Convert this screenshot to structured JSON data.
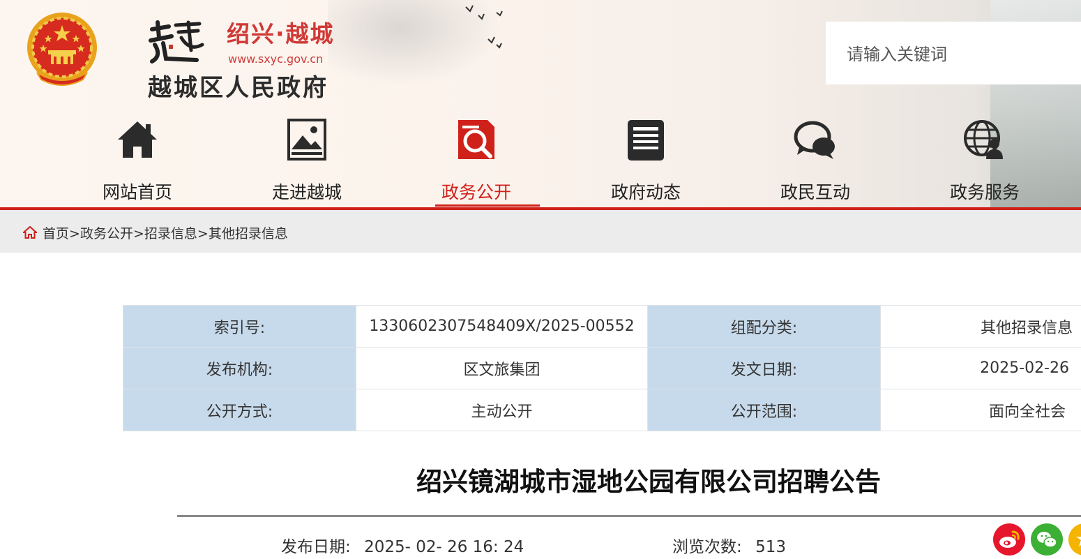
{
  "header": {
    "brand_red": "绍兴·越城",
    "brand_url": "www.sxyc.gov.cn",
    "brand_name": "越城区人民政府",
    "search_placeholder": "请输入关键词"
  },
  "nav": {
    "active": "政务公开",
    "items": [
      {
        "label": "网站首页",
        "icon": "home-icon"
      },
      {
        "label": "走进越城",
        "icon": "picture-icon"
      },
      {
        "label": "政务公开",
        "icon": "search-document-icon"
      },
      {
        "label": "政府动态",
        "icon": "news-icon"
      },
      {
        "label": "政民互动",
        "icon": "chat-icon"
      },
      {
        "label": "政务服务",
        "icon": "globe-user-icon"
      }
    ]
  },
  "breadcrumb": {
    "items": [
      "首页",
      "政务公开",
      "招录信息",
      "其他招录信息"
    ],
    "separator": ">"
  },
  "info": {
    "index_label": "索引号:",
    "index_value": "1330602307548409X/2025-00552",
    "category_label": "组配分类:",
    "category_value": "其他招录信息",
    "publisher_label": "发布机构:",
    "publisher_value": "区文旅集团",
    "doc_date_label": "发文日期:",
    "doc_date_value": "2025-02-26",
    "open_mode_label": "公开方式:",
    "open_mode_value": "主动公开",
    "open_scope_label": "公开范围:",
    "open_scope_value": "面向全社会"
  },
  "article": {
    "title": "绍兴镜湖城市湿地公园有限公司招聘公告",
    "publish_label": "发布日期:",
    "publish_value": "2025- 02- 26 16: 24",
    "views_label": "浏览次数:",
    "views_value": "513"
  },
  "colors": {
    "accent_red": "#d0201a",
    "table_key_bg": "#c7daeb",
    "breadcrumb_bg": "#ececec"
  }
}
